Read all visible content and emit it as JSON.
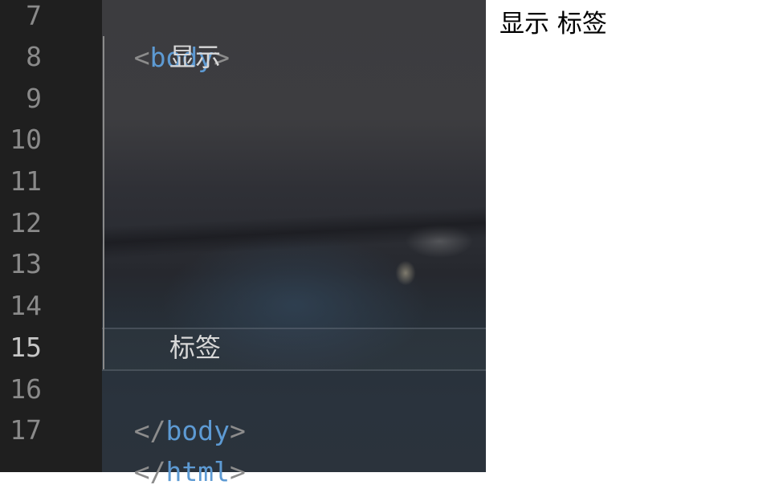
{
  "editor": {
    "line_numbers": [
      "7",
      "8",
      "9",
      "10",
      "11",
      "12",
      "13",
      "14",
      "15",
      "16",
      "17"
    ],
    "current_line": "15",
    "lines": {
      "body_open": {
        "open": "<",
        "tag": "body",
        "close": ">"
      },
      "text1": "显示",
      "text2": "标签",
      "body_close": {
        "open": "</",
        "tag": "body",
        "close": ">"
      },
      "html_close": {
        "open": "</",
        "tag": "html",
        "close": ">"
      }
    }
  },
  "preview": {
    "text": "显示 标签"
  },
  "colors": {
    "tag": "#5d9ad3",
    "punctuation": "#8c8c8c",
    "gutter_bg": "#1f1f1f",
    "preview_bg": "#ffffff"
  }
}
